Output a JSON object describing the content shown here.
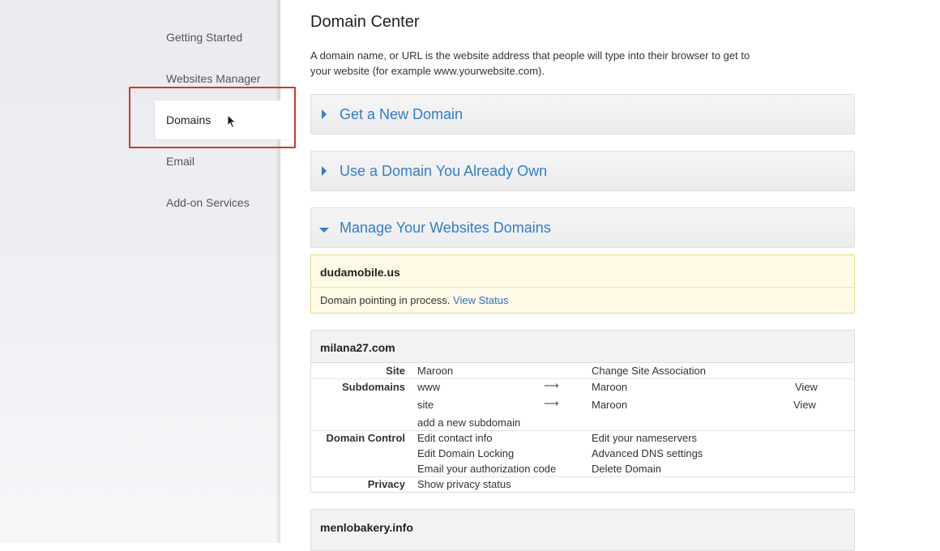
{
  "sidebar": {
    "items": [
      {
        "label": "Getting Started"
      },
      {
        "label": "Websites Manager"
      },
      {
        "label": "Domains",
        "active": true
      },
      {
        "label": "Email"
      },
      {
        "label": "Add-on Services"
      }
    ]
  },
  "main": {
    "title": "Domain Center",
    "intro": "A domain name, or URL is the website address that people will type into their browser to get to your website (for example www.yourwebsite.com).",
    "accordions": [
      {
        "label": "Get a New Domain",
        "expanded": false
      },
      {
        "label": "Use a Domain You Already Own",
        "expanded": false
      },
      {
        "label": "Manage Your Websites Domains",
        "expanded": true
      }
    ],
    "pending_domain": {
      "name": "dudamobile.us",
      "status_text": "Domain pointing in process.",
      "status_link": "View Status"
    },
    "domain": {
      "name": "milana27.com",
      "site_label": "Site",
      "site_value": "Maroon",
      "change_site_link": "Change Site Association",
      "subdomains_label": "Subdomains",
      "subdomains": [
        {
          "name": "www",
          "arrow": "⟶",
          "target": "Maroon",
          "view": "View"
        },
        {
          "name": "site",
          "arrow": "⟶",
          "target": "Maroon",
          "view": "View"
        }
      ],
      "add_subdomain": "add a new subdomain",
      "domain_control_label": "Domain Control",
      "control_links_left": [
        "Edit contact info",
        "Edit Domain Locking",
        "Email your authorization code"
      ],
      "control_links_right": [
        "Edit your nameservers",
        "Advanced DNS settings",
        "Delete Domain"
      ],
      "privacy_label": "Privacy",
      "privacy_link": "Show privacy status"
    },
    "next_domain": {
      "name": "menlobakery.info"
    }
  },
  "colors": {
    "link": "#2a6ec4",
    "accordion_title": "#2f7ed1",
    "highlight_box": "#d0392b",
    "pending_bg": "#fffbe6"
  },
  "icons": [
    "triangle-right-icon",
    "triangle-down-icon",
    "long-arrow-right-icon",
    "mouse-pointer-icon"
  ]
}
